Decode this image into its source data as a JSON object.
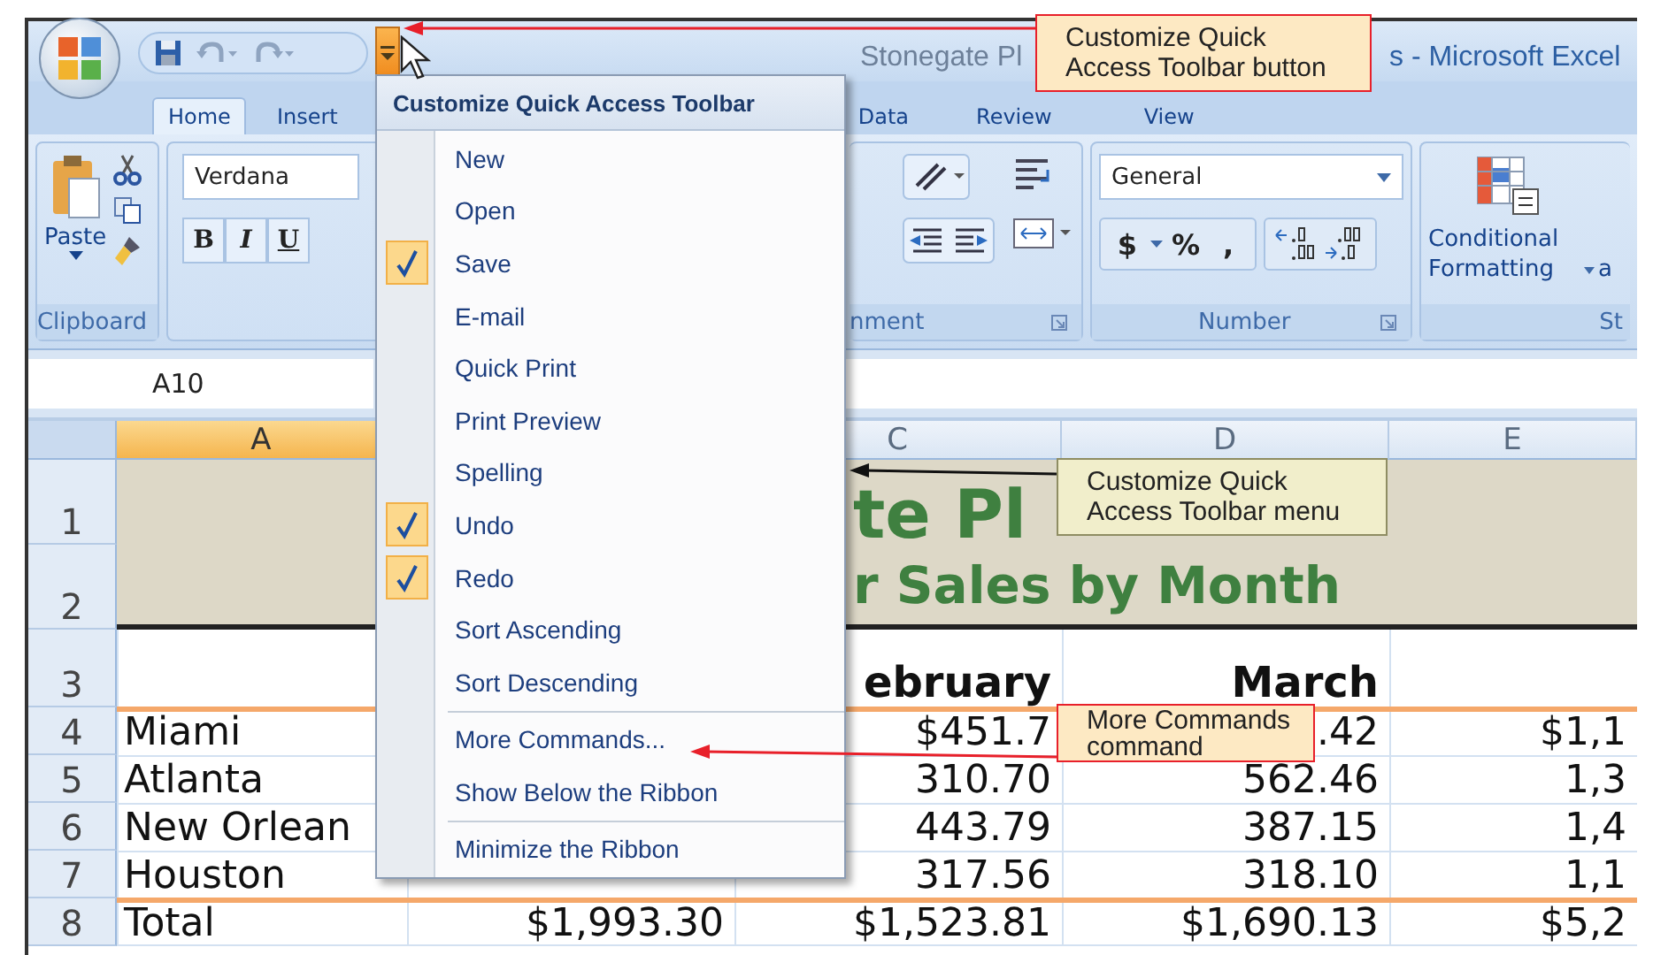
{
  "window": {
    "title_parts": [
      "Stonegate Pl",
      "s - Microsoft Excel"
    ]
  },
  "tabs": [
    {
      "label": "Home",
      "selected": true
    },
    {
      "label": "Insert",
      "selected": false
    },
    {
      "label": "Data",
      "selected": false
    },
    {
      "label": "Review",
      "selected": false
    },
    {
      "label": "View",
      "selected": false
    }
  ],
  "ribbon": {
    "clipboard": {
      "paste": "Paste",
      "label": "Clipboard"
    },
    "font": {
      "name": "Verdana",
      "styles": [
        "B",
        "I",
        "U"
      ]
    },
    "alignment": {
      "label": "nment"
    },
    "number": {
      "format": "General",
      "symbols": [
        "$",
        "%",
        ","
      ],
      "label": "Number"
    },
    "styles": {
      "command": "Conditional Formatting",
      "cut_text": "a",
      "label": "St"
    }
  },
  "formula_bar": {
    "name_box": "A10"
  },
  "sheet": {
    "columns": [
      {
        "label": "A",
        "selected": true
      },
      {
        "label": "C",
        "selected": false
      },
      {
        "label": "D",
        "selected": false
      },
      {
        "label": "E",
        "selected": false
      }
    ],
    "title": "te Pl",
    "subtitle": "r Sales by Month",
    "rows": [
      {
        "header": "1"
      },
      {
        "header": "2"
      },
      {
        "header": "3",
        "c": "ebruary",
        "d": "March"
      },
      {
        "header": "4",
        "a": "Miami",
        "c": "$451.7",
        "d": ".42",
        "e": "$1,1"
      },
      {
        "header": "5",
        "a": "Atlanta",
        "c": "310.70",
        "d": "562.46",
        "e": "1,3"
      },
      {
        "header": "6",
        "a": "New Orlean",
        "c": "443.79",
        "d": "387.15",
        "e": "1,4"
      },
      {
        "header": "7",
        "a": "Houston",
        "c": "317.56",
        "d": "318.10",
        "e": "1,1"
      },
      {
        "header": "8",
        "a": "Total",
        "b": "$1,993.30",
        "c": "$1,523.81",
        "d": "$1,690.13",
        "e": "$5,2"
      }
    ]
  },
  "menu": {
    "title": "Customize Quick Access Toolbar",
    "sections": [
      {
        "items": [
          {
            "label": "New",
            "checked": false
          },
          {
            "label": "Open",
            "checked": false
          },
          {
            "label": "Save",
            "checked": true
          },
          {
            "label": "E-mail",
            "checked": false
          },
          {
            "label": "Quick Print",
            "checked": false
          },
          {
            "label": "Print Preview",
            "checked": false
          },
          {
            "label": "Spelling",
            "checked": false
          },
          {
            "label": "Undo",
            "checked": true
          },
          {
            "label": "Redo",
            "checked": true
          },
          {
            "label": "Sort Ascending",
            "checked": false
          },
          {
            "label": "Sort Descending",
            "checked": false
          }
        ]
      },
      {
        "items": [
          {
            "label": "More Commands..."
          },
          {
            "label": "Show Below the Ribbon"
          }
        ]
      },
      {
        "items": [
          {
            "label": "Minimize the Ribbon"
          }
        ]
      }
    ]
  },
  "callouts": [
    {
      "text": "Customize Quick Access Toolbar button",
      "kind": "highlight"
    },
    {
      "text": "Customize Quick Access Toolbar menu",
      "kind": "plain"
    },
    {
      "text": "More Commands command",
      "kind": "highlight"
    }
  ]
}
